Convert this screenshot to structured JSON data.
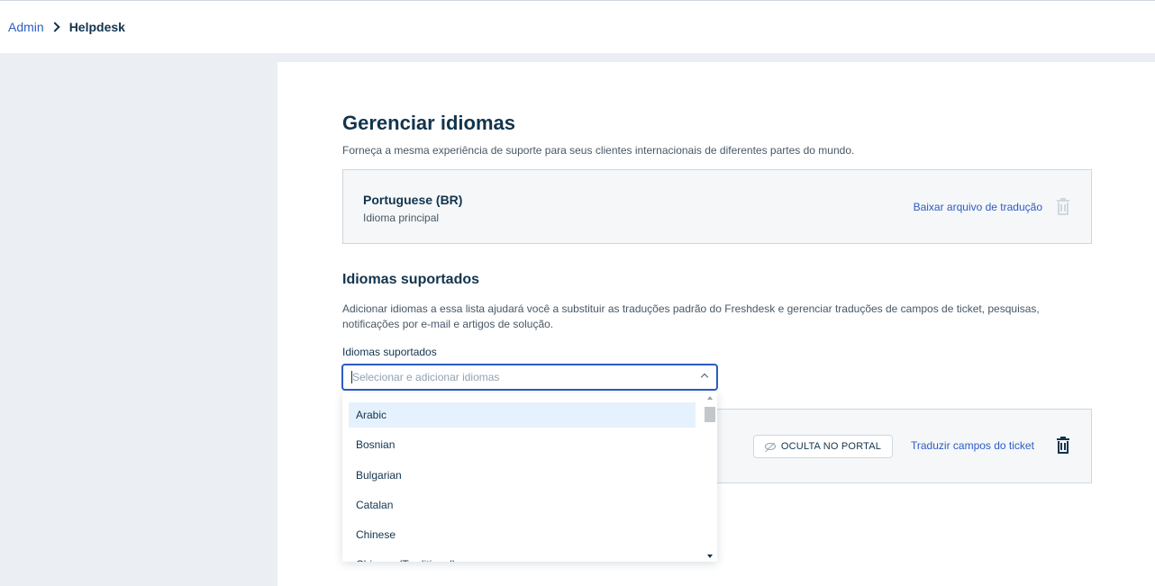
{
  "breadcrumb": {
    "admin_label": "Admin",
    "current_label": "Helpdesk"
  },
  "page": {
    "title": "Gerenciar idiomas",
    "description": "Forneça a mesma experiência de suporte para seus clientes internacionais de diferentes partes do mundo."
  },
  "primary_language": {
    "name": "Portuguese (BR)",
    "subtitle": "Idioma principal",
    "download_label": "Baixar arquivo de tradução",
    "trash_icon": "trash-icon",
    "trash_color": "#cfd7df"
  },
  "supported": {
    "title": "Idiomas suportados",
    "description": "Adicionar idiomas a essa lista ajudará você a substituir as traduções padrão do Freshdesk e gerenciar traduções de campos de ticket, pesquisas, notificações por e-mail e artigos de solução.",
    "field_label": "Idiomas suportados",
    "placeholder": "Selecionar e adicionar idiomas",
    "dropdown_open": true,
    "options": [
      "Arabic",
      "Bosnian",
      "Bulgarian",
      "Catalan",
      "Chinese",
      "Chinese (Traditional)"
    ],
    "highlighted_option": "Arabic"
  },
  "language_row": {
    "hidden_badge_label": "OCULTA NO PORTAL",
    "translate_label": "Traduzir campos do ticket",
    "trash_icon": "trash-icon"
  },
  "colors": {
    "accent": "#2c5cc5",
    "text": "#12344d",
    "muted": "#475867",
    "background": "#ebeff3",
    "highlight": "#e5f2fd"
  }
}
